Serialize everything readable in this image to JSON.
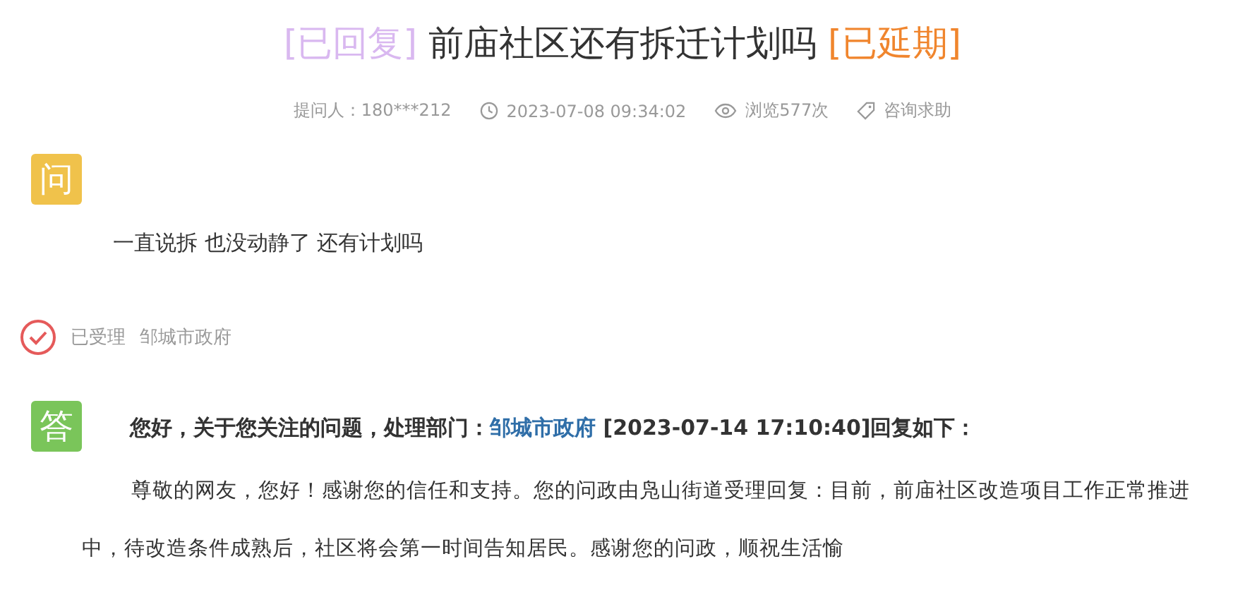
{
  "title": [
    {
      "kind": "replied",
      "text": "[已回复]"
    },
    {
      "kind": "plain",
      "text": "前庙社区还有拆迁计划吗"
    },
    {
      "kind": "delayed",
      "text": "[已延期]"
    }
  ],
  "meta": [
    {
      "kind": "asker",
      "text": "提问人：180***212"
    },
    {
      "kind": "time",
      "text": "2023-07-08 09:34:02"
    },
    {
      "kind": "views",
      "text": "浏览577次"
    },
    {
      "kind": "category",
      "text": "咨询求助"
    }
  ],
  "question": {
    "badge": "问",
    "text": "一直说拆 也没动静了 还有计划吗"
  },
  "status": {
    "accepted": true,
    "label": "已受理",
    "department": "邹城市政府"
  },
  "answer": {
    "badge": "答",
    "header_before": "您好，关于您关注的问题，处理部门：",
    "department_link": "邹城市政府",
    "header_after": "[2023-07-14 17:10:40]回复如下：",
    "body": "尊敬的网友，您好！感谢您的信任和支持。您的问政由凫山街道受理回复：目前，前庙社区改造项目工作正常推进中，待改造条件成熟后，社区将会第一时间告知居民。感谢您的问政，顺祝生活愉"
  }
}
